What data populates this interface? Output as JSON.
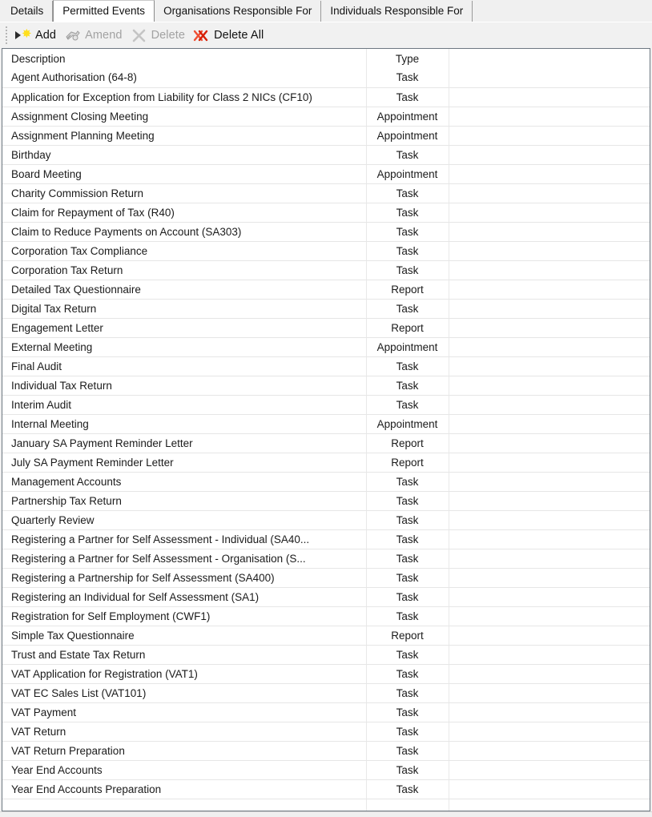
{
  "tabs": [
    {
      "label": "Details",
      "active": false
    },
    {
      "label": "Permitted Events",
      "active": true
    },
    {
      "label": "Organisations Responsible For",
      "active": false
    },
    {
      "label": "Individuals Responsible For",
      "active": false
    }
  ],
  "toolbar": {
    "add_label": "Add",
    "amend_label": "Amend",
    "delete_label": "Delete",
    "delete_all_label": "Delete All"
  },
  "grid": {
    "columns": [
      "Description",
      "Type",
      ""
    ],
    "rows": [
      {
        "description": "Agent Authorisation (64-8)",
        "type": "Task"
      },
      {
        "description": "Application for Exception from Liability for Class 2 NICs (CF10)",
        "type": "Task"
      },
      {
        "description": "Assignment Closing Meeting",
        "type": "Appointment"
      },
      {
        "description": "Assignment Planning Meeting",
        "type": "Appointment"
      },
      {
        "description": "Birthday",
        "type": "Task"
      },
      {
        "description": "Board Meeting",
        "type": "Appointment"
      },
      {
        "description": "Charity Commission Return",
        "type": "Task"
      },
      {
        "description": "Claim for Repayment of Tax (R40)",
        "type": "Task"
      },
      {
        "description": "Claim to Reduce Payments on Account (SA303)",
        "type": "Task"
      },
      {
        "description": "Corporation Tax Compliance",
        "type": "Task"
      },
      {
        "description": "Corporation Tax Return",
        "type": "Task"
      },
      {
        "description": "Detailed Tax Questionnaire",
        "type": "Report"
      },
      {
        "description": "Digital Tax Return",
        "type": "Task"
      },
      {
        "description": "Engagement Letter",
        "type": "Report"
      },
      {
        "description": "External Meeting",
        "type": "Appointment"
      },
      {
        "description": "Final Audit",
        "type": "Task"
      },
      {
        "description": "Individual Tax Return",
        "type": "Task"
      },
      {
        "description": "Interim Audit",
        "type": "Task"
      },
      {
        "description": "Internal Meeting",
        "type": "Appointment"
      },
      {
        "description": "January SA Payment Reminder Letter",
        "type": "Report"
      },
      {
        "description": "July SA Payment Reminder Letter",
        "type": "Report"
      },
      {
        "description": "Management Accounts",
        "type": "Task"
      },
      {
        "description": "Partnership Tax Return",
        "type": "Task"
      },
      {
        "description": "Quarterly Review",
        "type": "Task"
      },
      {
        "description": "Registering a Partner for Self Assessment - Individual (SA40...",
        "type": "Task"
      },
      {
        "description": "Registering a Partner for Self Assessment - Organisation (S...",
        "type": "Task"
      },
      {
        "description": "Registering a Partnership for Self Assessment (SA400)",
        "type": "Task"
      },
      {
        "description": "Registering an Individual for Self Assessment (SA1)",
        "type": "Task"
      },
      {
        "description": "Registration for Self Employment (CWF1)",
        "type": "Task"
      },
      {
        "description": "Simple Tax Questionnaire",
        "type": "Report"
      },
      {
        "description": "Trust and Estate Tax Return",
        "type": "Task"
      },
      {
        "description": "VAT Application for Registration (VAT1)",
        "type": "Task"
      },
      {
        "description": "VAT EC Sales List (VAT101)",
        "type": "Task"
      },
      {
        "description": "VAT Payment",
        "type": "Task"
      },
      {
        "description": "VAT Return",
        "type": "Task"
      },
      {
        "description": "VAT Return Preparation",
        "type": "Task"
      },
      {
        "description": "Year End Accounts",
        "type": "Task"
      },
      {
        "description": "Year End Accounts Preparation",
        "type": "Task"
      }
    ]
  },
  "colors": {
    "chrome": "#f0f0f0",
    "grid_border": "#6d7781",
    "row_rule": "#e6e6e6",
    "add_star": "#ffdf1b",
    "delete_all_red": "#e8341c",
    "disabled_text": "#a2a2a2"
  }
}
